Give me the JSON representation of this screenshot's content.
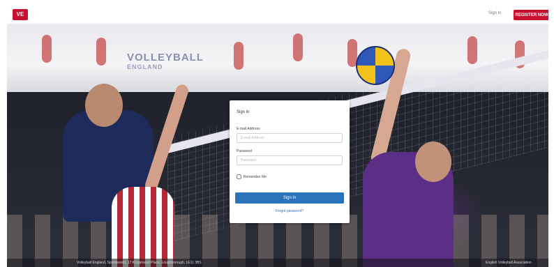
{
  "header": {
    "logo_text": "VE",
    "top_link": "Sign in",
    "register_button": "REGISTER NOW"
  },
  "banner": {
    "logo_line1": "VOLLEYBALL",
    "logo_line2": "ENGLAND"
  },
  "signin": {
    "title": "Sign in",
    "email_label": "E-mail Address",
    "email_placeholder": "E-mail Address",
    "password_label": "Password",
    "password_placeholder": "Password",
    "remember_label": "Remember Me",
    "submit_label": "Sign in",
    "forgot_link": "Forgot password?"
  },
  "footer": {
    "left_text": "Volleyball England, Sportsworld, 17 Kingsmead Place, Loughborough, LE11 3BS",
    "right_text": "English Volleyball Association"
  },
  "colors": {
    "brand_red": "#c8102e",
    "button_blue": "#2c74b9"
  }
}
